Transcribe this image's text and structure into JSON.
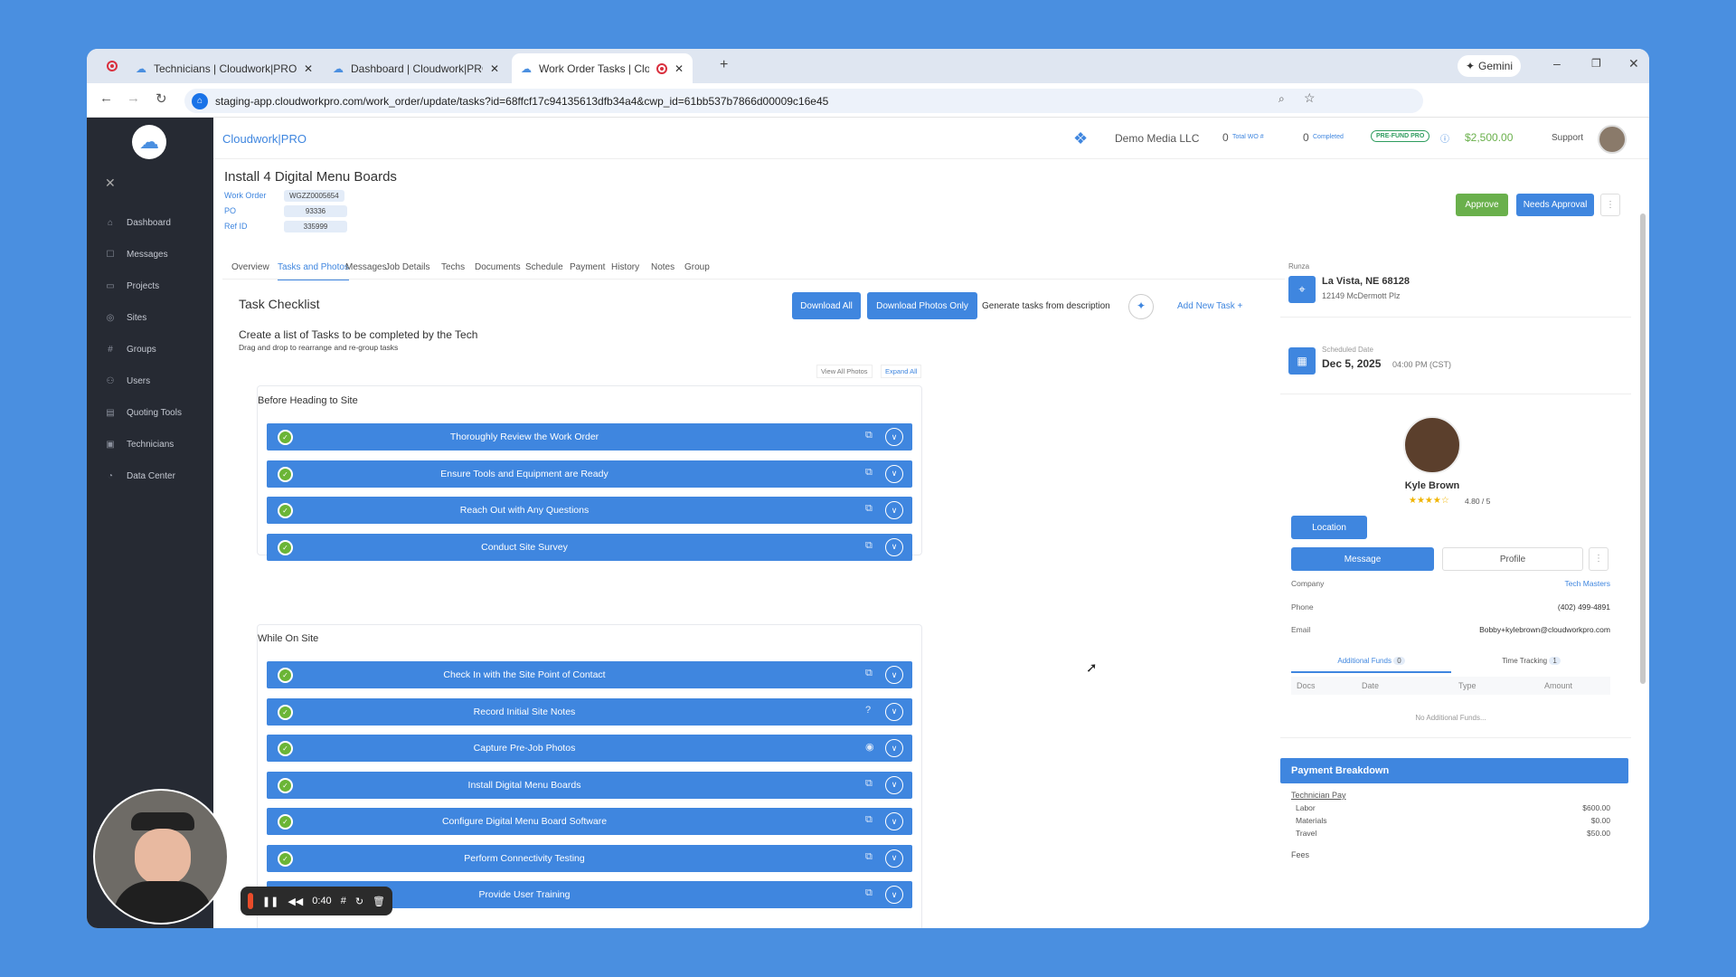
{
  "browser": {
    "tabs": [
      {
        "title": "Technicians | Cloudwork|PRO"
      },
      {
        "title": "Dashboard | Cloudwork|PRO"
      },
      {
        "title": "Work Order Tasks | Cloudw"
      }
    ],
    "url": "staging-app.cloudworkpro.com/work_order/update/tasks?id=68ffcf17c94135613dfb34a4&cwp_id=61bb537b7866d00009c16e45",
    "gemini": "Gemini"
  },
  "sidebar": {
    "items": [
      {
        "label": "Dashboard",
        "icon": "home-icon"
      },
      {
        "label": "Messages",
        "icon": "chat-icon"
      },
      {
        "label": "Projects",
        "icon": "folder-icon"
      },
      {
        "label": "Sites",
        "icon": "pin-icon"
      },
      {
        "label": "Groups",
        "icon": "hash-icon"
      },
      {
        "label": "Users",
        "icon": "users-icon"
      },
      {
        "label": "Quoting Tools",
        "icon": "doc-icon"
      },
      {
        "label": "Technicians",
        "icon": "id-icon"
      },
      {
        "label": "Data Center",
        "icon": "chart-icon"
      }
    ]
  },
  "header": {
    "brand": "Cloudwork|PRO",
    "company": "Demo Media LLC",
    "total_wo_count": "0",
    "total_wo_label": "Total WO #",
    "completed_count": "0",
    "completed_label": "Completed",
    "prefund": "PRE-FUND PRO",
    "balance": "$2,500.00",
    "support": "Support"
  },
  "work_order": {
    "title": "Install 4 Digital Menu Boards",
    "fields": [
      {
        "label": "Work Order",
        "value": "WGZZ0005654"
      },
      {
        "label": "PO",
        "value": "93336"
      },
      {
        "label": "Ref ID",
        "value": "335999"
      }
    ],
    "approve": "Approve",
    "needs_approval": "Needs Approval"
  },
  "tabs": [
    "Overview",
    "Tasks and Photos",
    "Messages",
    "Job Details",
    "Techs",
    "Documents",
    "Schedule",
    "Payment",
    "History",
    "Notes",
    "Group"
  ],
  "checklist": {
    "title": "Task Checklist",
    "download_all": "Download All",
    "download_photos": "Download Photos Only",
    "generate": "Generate tasks from description",
    "add_task": "Add New Task +",
    "subtitle": "Create a list of Tasks to be completed by the Tech",
    "hint": "Drag and drop to rearrange and re-group tasks",
    "view_all": "View All Photos",
    "expand_all": "Expand All",
    "groups": [
      {
        "name": "Before Heading to Site",
        "tasks": [
          "Thoroughly Review the Work Order",
          "Ensure Tools and Equipment are Ready",
          "Reach Out with Any Questions",
          "Conduct Site Survey"
        ]
      },
      {
        "name": "While On Site",
        "tasks": [
          "Check In with the Site Point of Contact",
          "Record Initial Site Notes",
          "Capture Pre-Job Photos",
          "Install Digital Menu Boards",
          "Configure Digital Menu Board Software",
          "Perform Connectivity Testing",
          "Provide User Training"
        ]
      }
    ]
  },
  "right": {
    "site_name": "Runza",
    "city": "La Vista, NE 68128",
    "street": "12149 McDermott Plz",
    "sched_label": "Scheduled Date",
    "sched_date": "Dec 5, 2025",
    "sched_time": "04:00 PM (CST)",
    "tech_name": "Kyle Brown",
    "rating": "4.80 / 5",
    "location_btn": "Location",
    "message_btn": "Message",
    "profile_btn": "Profile",
    "company_label": "Company",
    "company": "Tech Masters",
    "phone_label": "Phone",
    "phone": "(402) 499-4891",
    "email_label": "Email",
    "email": "Bobby+kylebrown@cloudworkpro.com",
    "tab_funds": "Additional Funds",
    "funds_count": "0",
    "tab_time": "Time Tracking",
    "time_count": "1",
    "cols": [
      "Docs",
      "Date",
      "Type",
      "Amount"
    ],
    "empty": "No Additional Funds...",
    "pay_title": "Payment Breakdown",
    "tech_pay": "Technician Pay",
    "pay_rows": [
      {
        "label": "Labor",
        "value": "$600.00"
      },
      {
        "label": "Materials",
        "value": "$0.00"
      },
      {
        "label": "Travel",
        "value": "$50.00"
      }
    ],
    "fees": "Fees"
  },
  "recorder": {
    "time": "0:40"
  },
  "colors": {
    "primary": "#3f86df",
    "sidebar": "#262a33",
    "approve": "#6ab04c",
    "desktop": "#4a8fe0"
  }
}
